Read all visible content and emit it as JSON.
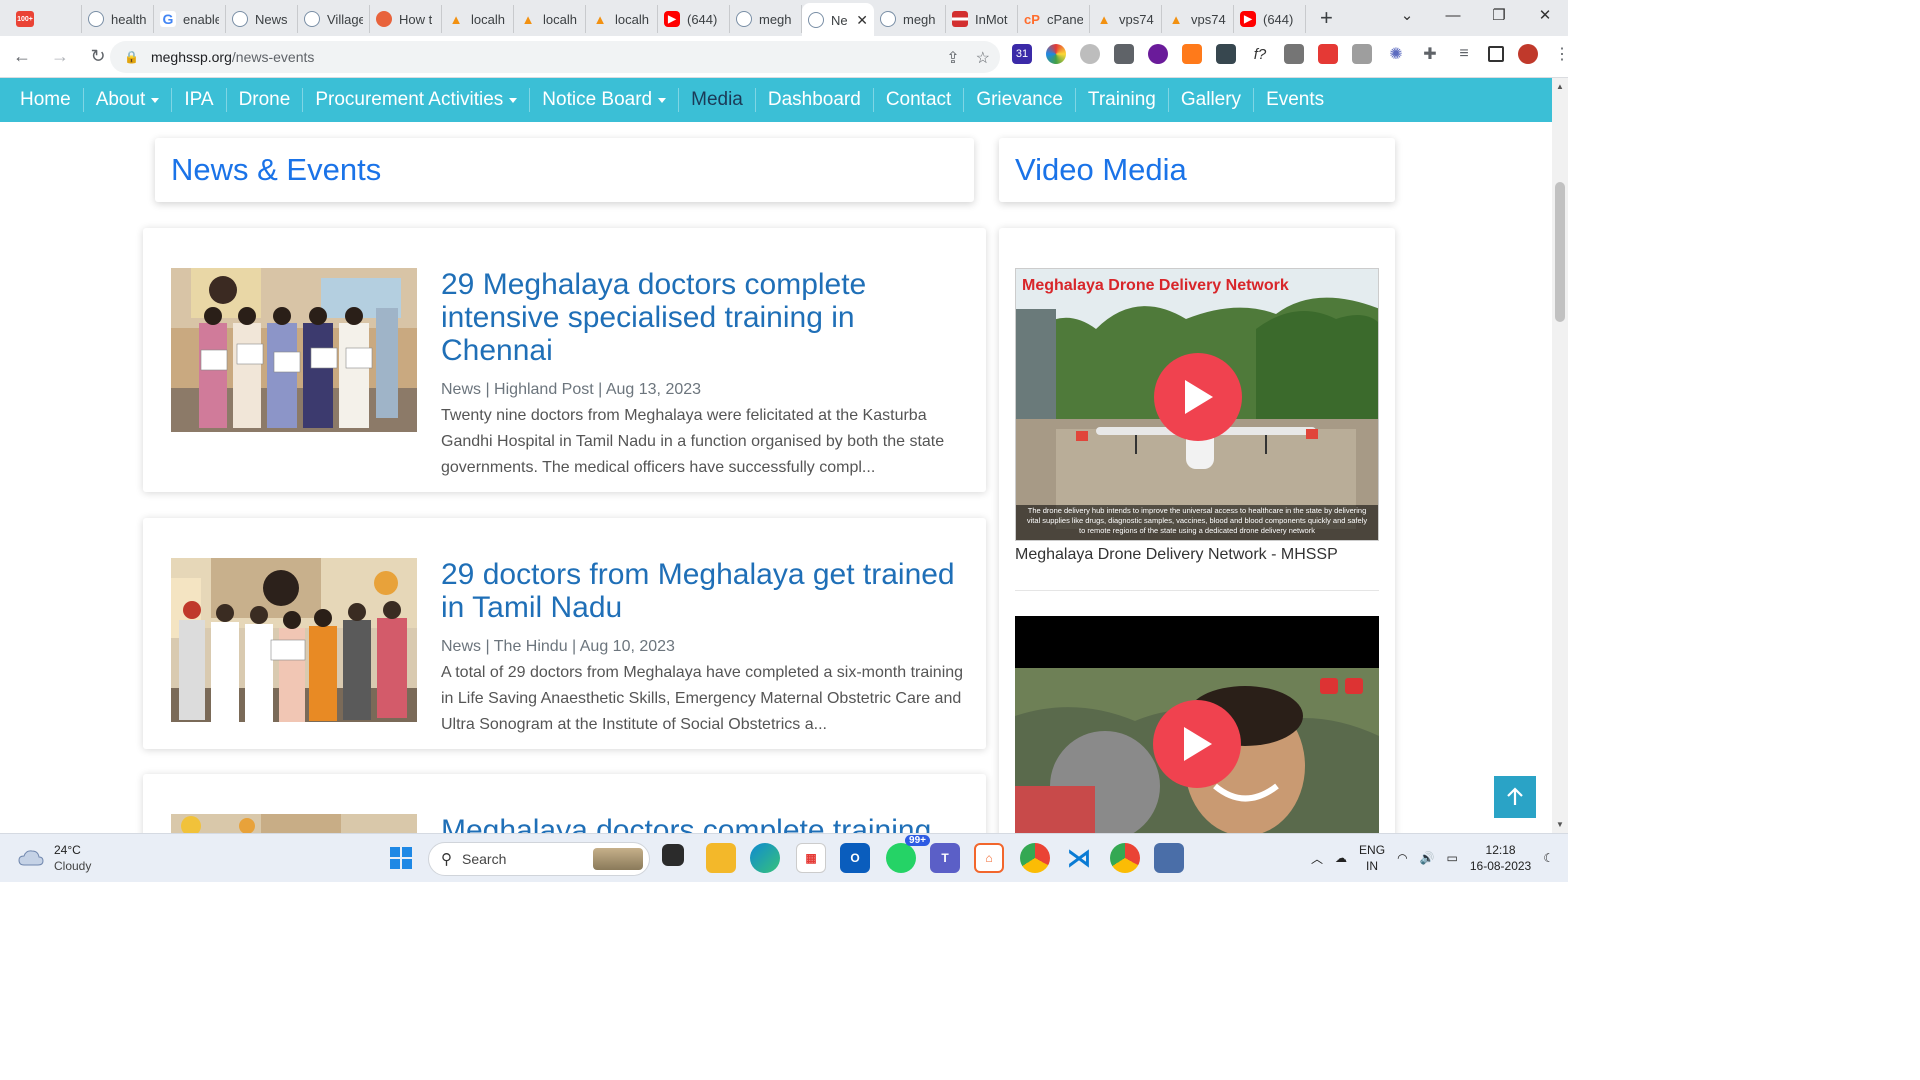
{
  "browser": {
    "tabs": [
      {
        "title": "",
        "icon": "gmail-icon",
        "badge": "100+"
      },
      {
        "title": "health",
        "icon": "globe-icon"
      },
      {
        "title": "enable",
        "icon": "google-icon"
      },
      {
        "title": "News",
        "icon": "globe-icon"
      },
      {
        "title": "Village",
        "icon": "globe-icon"
      },
      {
        "title": "How t",
        "icon": "orange-icon"
      },
      {
        "title": "localh",
        "icon": "phpmyadmin-icon"
      },
      {
        "title": "localh",
        "icon": "phpmyadmin-icon"
      },
      {
        "title": "localh",
        "icon": "phpmyadmin-icon"
      },
      {
        "title": "(644)",
        "icon": "youtube-icon"
      },
      {
        "title": "megh",
        "icon": "globe-icon"
      },
      {
        "title": "Ne",
        "icon": "globe-icon",
        "active": true
      },
      {
        "title": "megh",
        "icon": "globe-icon"
      },
      {
        "title": "InMot",
        "icon": "inmotion-icon"
      },
      {
        "title": "cPane",
        "icon": "cpanel-icon"
      },
      {
        "title": "vps74",
        "icon": "phpmyadmin-icon"
      },
      {
        "title": "vps74",
        "icon": "phpmyadmin-icon"
      },
      {
        "title": "(644)",
        "icon": "youtube-icon"
      }
    ],
    "url_host": "meghssp.org",
    "url_path": "/news-events"
  },
  "nav": {
    "items": [
      {
        "label": "Home"
      },
      {
        "label": "About",
        "dropdown": true
      },
      {
        "label": "IPA"
      },
      {
        "label": "Drone"
      },
      {
        "label": "Procurement Activities",
        "dropdown": true
      },
      {
        "label": "Notice Board",
        "dropdown": true
      },
      {
        "label": "Media",
        "active": true
      },
      {
        "label": "Dashboard"
      },
      {
        "label": "Contact"
      },
      {
        "label": "Grievance"
      },
      {
        "label": "Training"
      },
      {
        "label": "Gallery"
      },
      {
        "label": "Events"
      }
    ]
  },
  "main": {
    "heading": "News & Events",
    "news": [
      {
        "title": "29 Meghalaya doctors complete intensive specialised training in Chennai",
        "meta": "News | Highland Post | Aug 13, 2023",
        "excerpt": "Twenty nine doctors from Meghalaya were felicitated at the Kasturba Gandhi Hospital in Tamil Nadu in a function organised by both the state governments. The medical officers have successfully compl..."
      },
      {
        "title": "29 doctors from Meghalaya get trained in Tamil Nadu",
        "meta": "News | The Hindu | Aug 10, 2023",
        "excerpt": "A total of 29 doctors from Meghalaya have completed a six-month training in Life Saving Anaesthetic Skills, Emergency Maternal Obstetric Care and Ultra Sonogram at the Institute of Social Obstetrics a..."
      },
      {
        "title": "Meghalaya doctors complete training",
        "meta": "",
        "excerpt": ""
      }
    ]
  },
  "sidebar": {
    "heading": "Video Media",
    "videos": [
      {
        "title": "Meghalaya Drone Delivery Network - MHSSP",
        "thumb_title": "Meghalaya Drone Delivery Network",
        "thumb_caption": "The drone delivery hub intends to improve the universal access to healthcare in the state by delivering vital supplies like drugs, diagnostic samples, vaccines, blood and blood components quickly and safely to remote regions of the state using a dedicated drone delivery network"
      },
      {
        "title": ""
      }
    ]
  },
  "taskbar": {
    "weather_temp": "24°C",
    "weather_cond": "Cloudy",
    "search_placeholder": "Search",
    "whatsapp_badge": "99+",
    "lang_top": "ENG",
    "lang_bottom": "IN",
    "time": "12:18",
    "date": "16-08-2023"
  }
}
